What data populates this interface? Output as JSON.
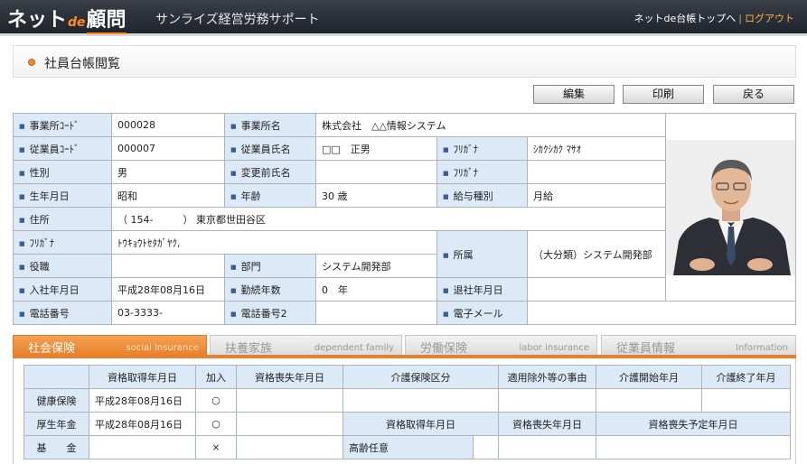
{
  "header": {
    "logo_part1": "ネット",
    "logo_part2": "de",
    "logo_part3": "顧問",
    "company_name": "サンライズ経営労務サポート",
    "link_top": "ネットde台帳トップへ",
    "link_sep": "|",
    "link_logout": "ログアウト"
  },
  "page": {
    "title": "社員台帳閲覧"
  },
  "actions": {
    "edit": "編集",
    "print": "印刷",
    "back": "戻る"
  },
  "employee": {
    "office_code_label": "事業所ｺｰﾄﾞ",
    "office_code": "000028",
    "office_name_label": "事業所名",
    "office_name": "株式会社　△△情報システム",
    "emp_code_label": "従業員ｺｰﾄﾞ",
    "emp_code": "000007",
    "emp_name_label": "従業員氏名",
    "emp_name": "□□　正男",
    "kana_label": "ﾌﾘｶﾞﾅ",
    "kana": "ｼｶｸｼｶｸ ﾏｻｵ",
    "gender_label": "性別",
    "gender": "男",
    "prev_name_label": "変更前氏名",
    "prev_name": "",
    "prev_kana_label": "ﾌﾘｶﾞﾅ",
    "prev_kana": "",
    "birth_label": "生年月日",
    "birth": "昭和",
    "age_label": "年齢",
    "age": "30 歳",
    "salary_type_label": "給与種別",
    "salary_type": "月給",
    "address_label": "住所",
    "address": "（ 154-　　　）  東京都世田谷区",
    "address_kana_label": "ﾌﾘｶﾞﾅ",
    "address_kana": "ﾄｳｷｮｳﾄｾﾀｶﾞﾔｸ,",
    "affiliation_label": "所属",
    "affiliation": "（大分類）システム開発部",
    "position_label": "役職",
    "position": "",
    "department_label": "部門",
    "department": "システム開発部",
    "join_date_label": "入社年月日",
    "join_date": "平成28年08月16日",
    "years_label": "勤続年数",
    "years": "0　年",
    "leave_date_label": "退社年月日",
    "leave_date": "",
    "phone_label": "電話番号",
    "phone": "03-3333-",
    "phone2_label": "電話番号2",
    "phone2": "",
    "email_label": "電子メール",
    "email": ""
  },
  "tabs": [
    {
      "jp": "社会保険",
      "en": "social insurance"
    },
    {
      "jp": "扶養家族",
      "en": "dependent family"
    },
    {
      "jp": "労働保険",
      "en": "labor insurance"
    },
    {
      "jp": "従業員情報",
      "en": "Information"
    }
  ],
  "insurance": {
    "headers": [
      "資格取得年月日",
      "加入",
      "資格喪失年月日",
      "介護保険区分",
      "適用除外等の事由",
      "介護開始年月",
      "介護終了年月"
    ],
    "health_label": "健康保険",
    "health_date": "平成28年08月16日",
    "health_join": "○",
    "pension_label": "厚生年金",
    "pension_date": "平成28年08月16日",
    "pension_join": "○",
    "pension_headers": [
      "資格取得年月日",
      "資格喪失年月日",
      "資格喪失予定年月日"
    ],
    "fund_label": "基　　金",
    "fund_join": "×",
    "elderly_label": "高齢任意"
  }
}
